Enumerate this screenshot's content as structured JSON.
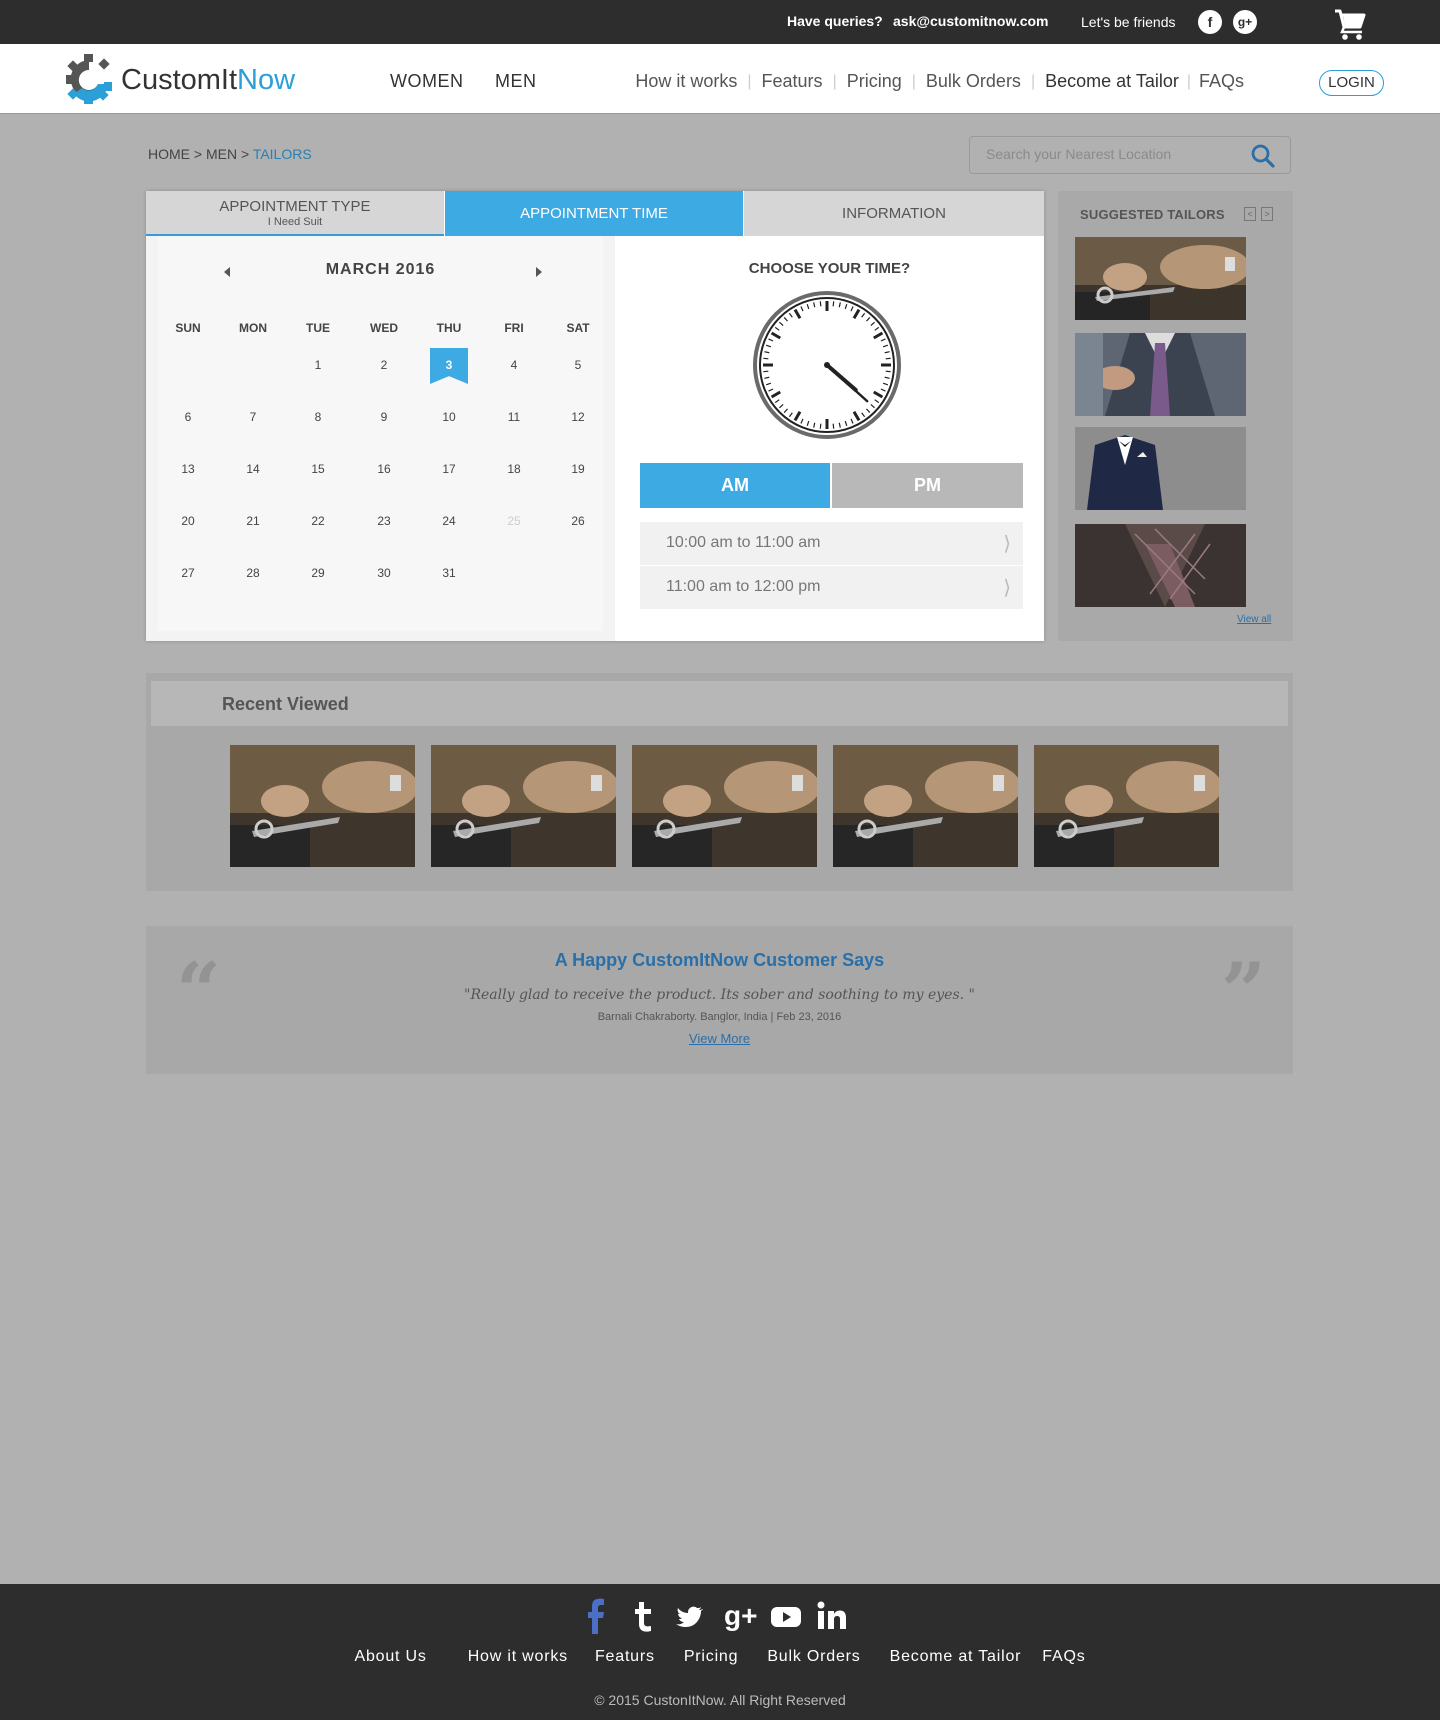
{
  "topbar": {
    "queries_label": "Have queries?",
    "email": "ask@customitnow.com",
    "friends_label": "Let's be friends",
    "facebook_icon": "f",
    "gplus_icon": "g+"
  },
  "header": {
    "brand_main": "CustomIt",
    "brand_accent": "Now",
    "categories": [
      "WOMEN",
      "MEN"
    ],
    "nav": [
      "How it works",
      "Featurs",
      "Pricing",
      "Bulk Orders",
      "Become at Tailor",
      "FAQs"
    ],
    "login_label": "LOGIN",
    "accent_color": "#2a9fd8"
  },
  "breadcrumb": {
    "home": "HOME",
    "sep": ">",
    "men": "MEN",
    "current": "TAILORS"
  },
  "search": {
    "placeholder": "Search your Nearest Location"
  },
  "booking": {
    "tabs": {
      "type_label": "APPOINTMENT TYPE",
      "type_sub": "I Need Suit",
      "time_label": "APPOINTMENT TIME",
      "info_label": "INFORMATION"
    },
    "calendar": {
      "month": "MARCH 2016",
      "weekdays": [
        "SUN",
        "MON",
        "TUE",
        "WED",
        "THU",
        "FRI",
        "SAT"
      ],
      "days": [
        "1",
        "2",
        "3",
        "4",
        "5",
        "6",
        "7",
        "8",
        "9",
        "10",
        "11",
        "12",
        "13",
        "14",
        "15",
        "16",
        "17",
        "18",
        "19",
        "20",
        "21",
        "22",
        "23",
        "24",
        "25",
        "26",
        "27",
        "28",
        "29",
        "30",
        "31"
      ],
      "selected": "3",
      "disabled": "25"
    },
    "time": {
      "title": "CHOOSE YOUR TIME?",
      "clock_time": "04:22",
      "am_label": "AM",
      "pm_label": "PM",
      "selected_period": "AM",
      "slots": [
        "10:00 am to 11:00 am",
        "11:00 am to 12:00 pm"
      ]
    }
  },
  "suggested": {
    "title": "SUGGESTED TAILORS",
    "prev_icon": "<",
    "next_icon": ">",
    "view_all": "View all"
  },
  "recent": {
    "title": "Recent Viewed"
  },
  "testimonial": {
    "title": "A Happy CustomItNow Customer Says",
    "quote": "\"Really glad to receive the product. Its sober and soothing to my eyes. \"",
    "author": "Barnali Chakraborty. Banglor, India | Feb 23, 2016",
    "more": "View More",
    "open_quote": "“",
    "close_quote": "”"
  },
  "footer": {
    "social_icons": [
      "facebook-icon",
      "tumblr-icon",
      "twitter-icon",
      "googleplus-icon",
      "youtube-icon",
      "linkedin-icon"
    ],
    "links": [
      "About Us",
      "How it works",
      "Featurs",
      "Pricing",
      "Bulk Orders",
      "Become at Tailor",
      "FAQs"
    ],
    "copyright": "© 2015 CustonItNow. All Right Reserved"
  }
}
